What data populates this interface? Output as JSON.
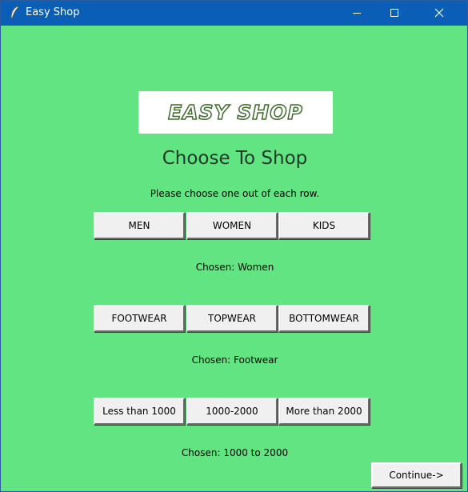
{
  "window": {
    "title": "Easy Shop",
    "icon": "feather-icon",
    "controls": [
      "minimize-icon",
      "maximize-icon",
      "close-icon"
    ]
  },
  "logo": {
    "text": "EASY SHOP"
  },
  "heading": "Choose To Shop",
  "instruction": "Please choose one out of each row.",
  "rows": [
    {
      "buttons": [
        "MEN",
        "WOMEN",
        "KIDS"
      ],
      "chosen": "Chosen: Women"
    },
    {
      "buttons": [
        "FOOTWEAR",
        "TOPWEAR",
        "BOTTOMWEAR"
      ],
      "chosen": "Chosen: Footwear"
    },
    {
      "buttons": [
        "Less than 1000",
        "1000-2000",
        "More than 2000"
      ],
      "chosen": "Chosen: 1000 to 2000"
    }
  ],
  "continue_label": "Continue->",
  "colors": {
    "background": "#62e483",
    "titlebar": "#0a5eb5",
    "button": "#f0f0f0"
  }
}
